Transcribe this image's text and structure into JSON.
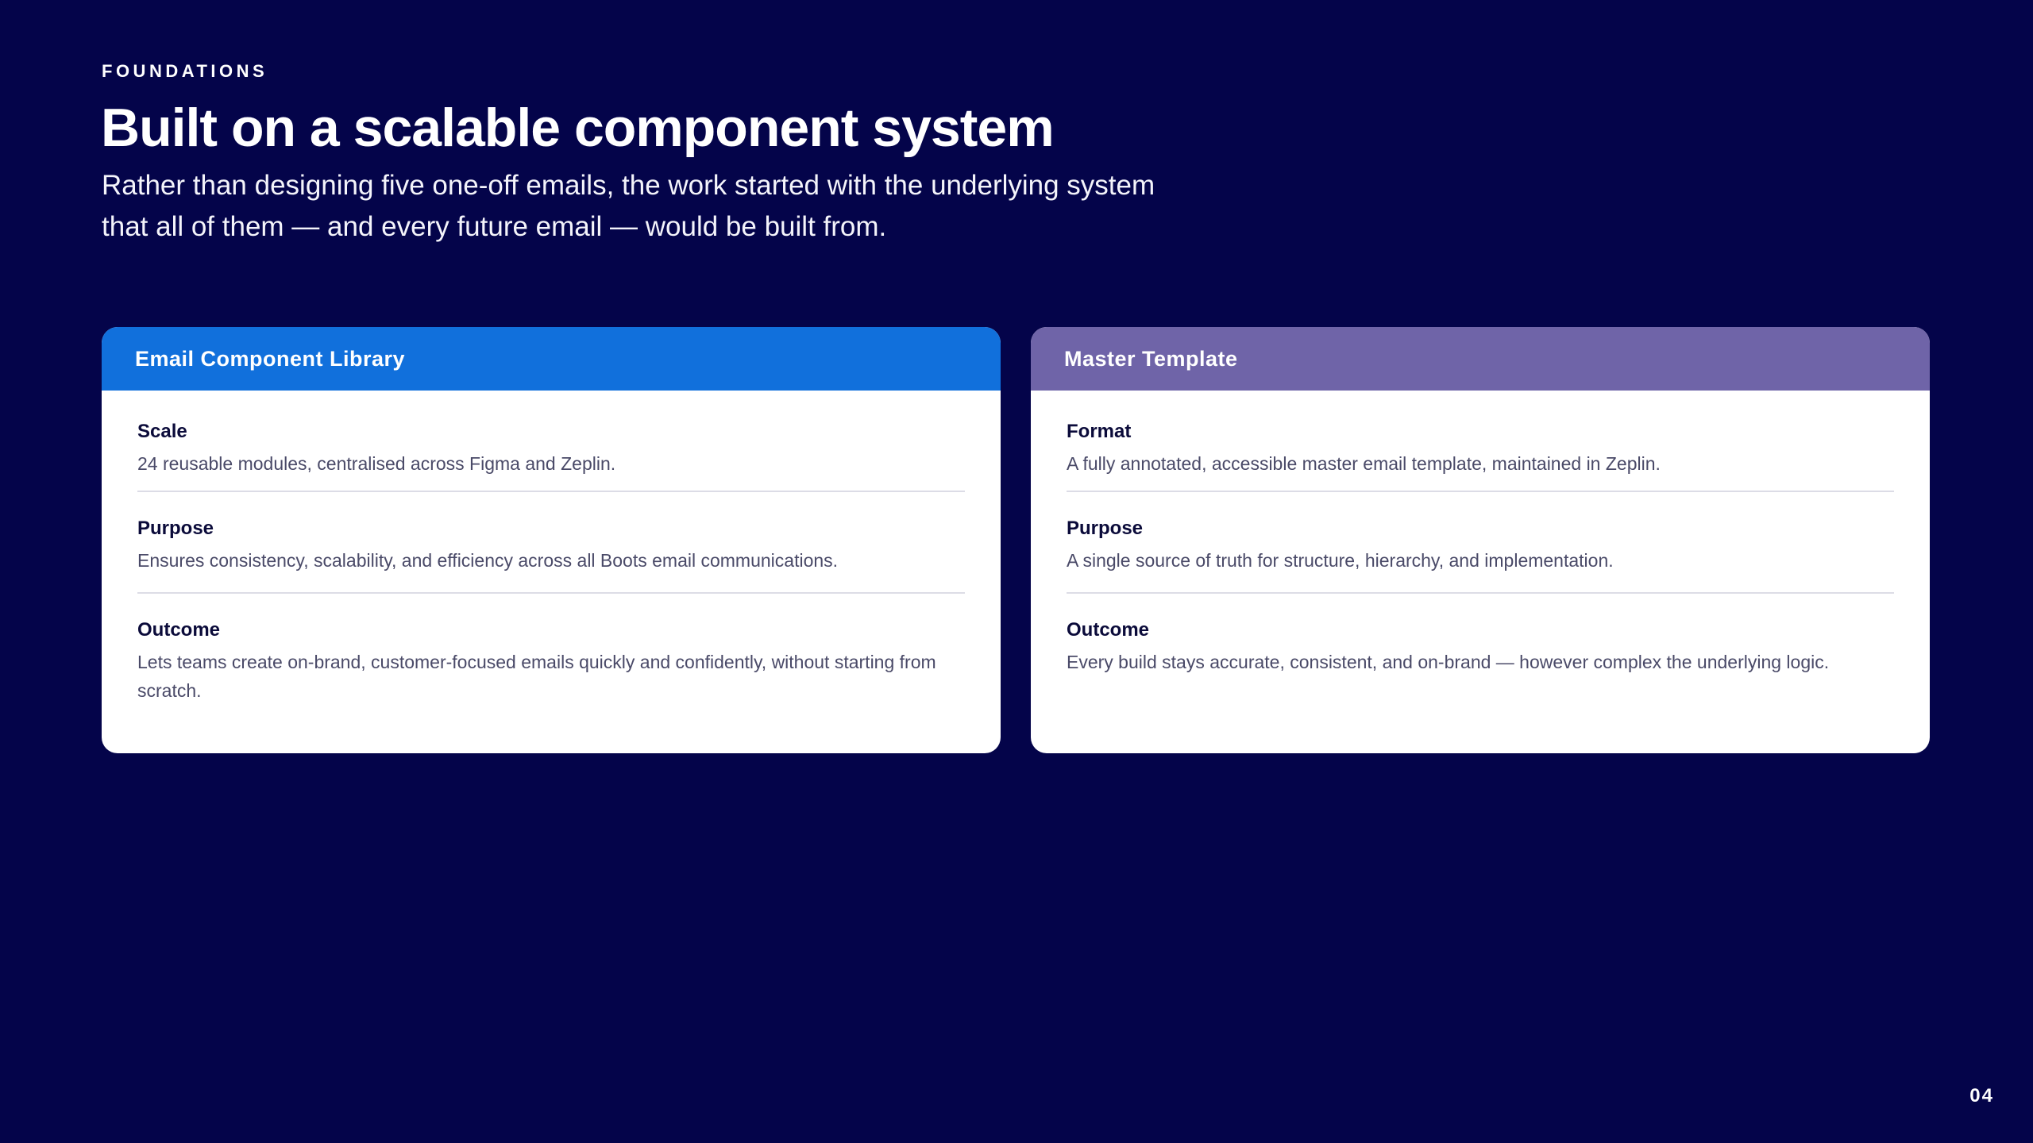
{
  "header": {
    "eyebrow": "FOUNDATIONS",
    "title": "Built on a scalable component system",
    "subtitle": "Rather than designing five one-off emails, the work started with the underlying system that all of them — and every future email — would be built from."
  },
  "cards": [
    {
      "title": "Email Component Library",
      "accent": "#1170dc",
      "rows": [
        {
          "label": "Scale",
          "text": "24 reusable modules, centralised across Figma and Zeplin."
        },
        {
          "label": "Purpose",
          "text": "Ensures consistency, scalability, and efficiency across all Boots email communications."
        },
        {
          "label": "Outcome",
          "text": "Lets teams create on-brand, customer-focused emails quickly and confidently, without starting from scratch."
        }
      ]
    },
    {
      "title": "Master Template",
      "accent": "#6f64a8",
      "rows": [
        {
          "label": "Format",
          "text": "A fully annotated, accessible master email template, maintained in Zeplin."
        },
        {
          "label": "Purpose",
          "text": "A single source of truth for structure, hierarchy, and implementation."
        },
        {
          "label": "Outcome",
          "text": "Every build stays accurate, consistent, and on-brand — however complex the underlying logic."
        }
      ]
    }
  ],
  "page_number": "04",
  "colors": {
    "background": "#04044a",
    "card_background": "#ffffff",
    "divider": "#dcdce6"
  }
}
